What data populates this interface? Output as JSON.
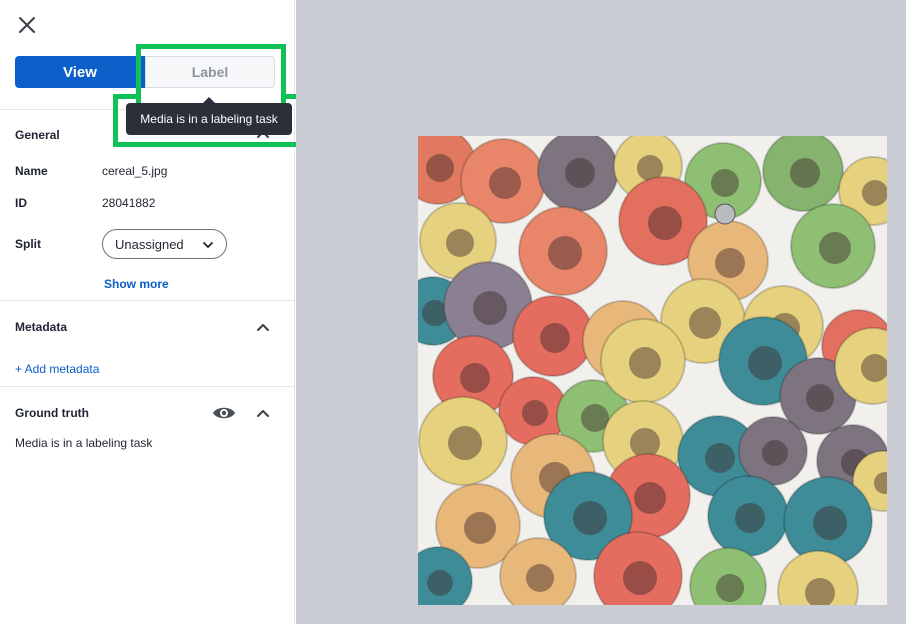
{
  "header": {
    "close_icon": "close-icon"
  },
  "mode_toggle": {
    "view_label": "View",
    "label_label": "Label",
    "active": "View",
    "active_color": "#0a5fc9"
  },
  "tooltip": {
    "text": "Media is in a labeling task"
  },
  "general": {
    "title": "General",
    "name_key": "Name",
    "name_value": "cereal_5.jpg",
    "id_key": "ID",
    "id_value": "28041882",
    "split_key": "Split",
    "split_value": "Unassigned",
    "show_more": "Show more"
  },
  "metadata": {
    "title": "Metadata",
    "add_link": "+ Add metadata"
  },
  "ground_truth": {
    "title": "Ground truth",
    "message": "Media is in a labeling task"
  },
  "highlight_color": "#0fc257"
}
